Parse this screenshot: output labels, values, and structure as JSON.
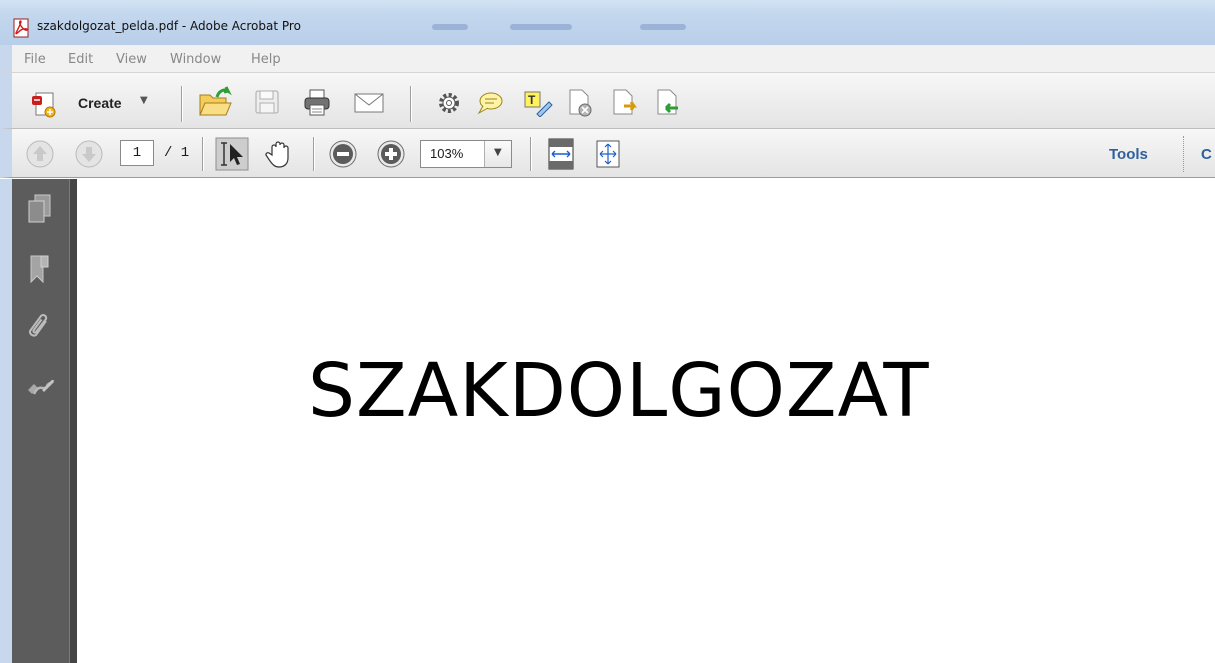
{
  "window": {
    "title": "szakdolgozat_pelda.pdf - Adobe Acrobat Pro"
  },
  "menu": {
    "items": [
      "File",
      "Edit",
      "View",
      "Window",
      "Help"
    ]
  },
  "toolbar": {
    "create_label": "Create",
    "icons": [
      "open-icon",
      "save-icon",
      "print-icon",
      "email-icon",
      "settings-icon",
      "comment-icon",
      "highlight-icon",
      "delete-page-icon",
      "extract-page-icon",
      "insert-page-icon"
    ]
  },
  "navigation": {
    "current_page": "1",
    "total_pages": "/ 1",
    "zoom": "103%",
    "tools_label": "Tools",
    "comment_label_partial": "C"
  },
  "navpane": {
    "icons": [
      "pages-icon",
      "bookmarks-icon",
      "attachments-icon",
      "signatures-icon"
    ]
  },
  "document": {
    "heading": "SZAKDOLGOZAT"
  },
  "colors": {
    "title_bar": "#c3d7ee",
    "nav_pane": "#5c5c5c",
    "link_blue": "#2f5f9c"
  }
}
